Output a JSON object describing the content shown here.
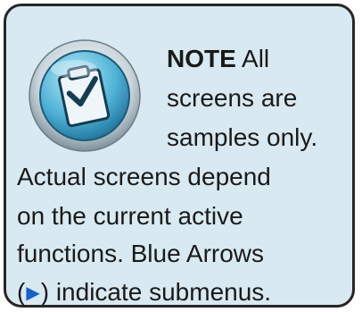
{
  "note": {
    "label": "NOTE",
    "line1_rest": " All",
    "line2": "screens are",
    "line3": "samples only.",
    "line4": "Actual screens depend",
    "line5": "on the current active",
    "line6": "functions. Blue Arrows",
    "paren_open": "(",
    "arrow_glyph": "▶",
    "line7_rest": ") indicate submenus.",
    "icon": "clipboard-checkmark-icon"
  },
  "colors": {
    "card_background": "#d9e9f1",
    "card_border": "#262626",
    "text": "#1a1a1a",
    "arrow": "#1560c9"
  }
}
